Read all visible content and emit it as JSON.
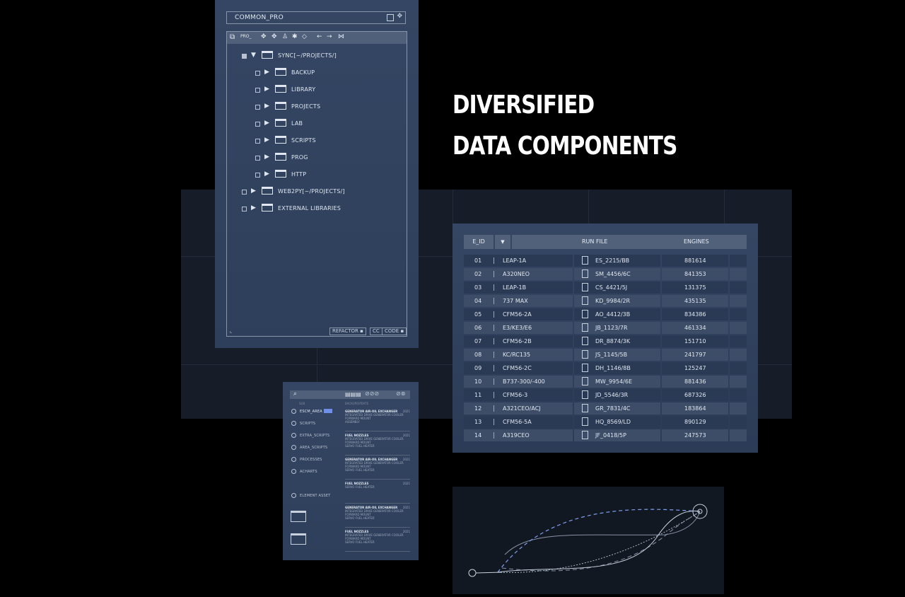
{
  "headline": {
    "line1": "DIVERSIFIED",
    "line2": "DATA COMPONENTS"
  },
  "tree": {
    "title": "COMMON_PRO",
    "toolbar_label": "PRO_",
    "nodes": [
      {
        "label": "SYNC[~/PROJECTS/]",
        "expanded": true,
        "checked": true
      },
      {
        "label": "BACKUP"
      },
      {
        "label": "LIBRARY"
      },
      {
        "label": "PROJECTS"
      },
      {
        "label": "LAB"
      },
      {
        "label": "SCRIPTS"
      },
      {
        "label": "PROG"
      },
      {
        "label": "HTTP"
      },
      {
        "label": "WEB2PY[~/PROJECTS/]"
      },
      {
        "label": "EXTERNAL LIBRARIES"
      }
    ],
    "footer": {
      "refactor": "REFACTOR",
      "cc": "CC",
      "code": "CODE"
    }
  },
  "table": {
    "headers": {
      "id": "E_ID",
      "file": "RUN FILE",
      "engines": "ENGINES"
    },
    "rows": [
      {
        "id": "01",
        "name": "LEAP-1A",
        "file": "ES_2215/BB",
        "engines": "881614"
      },
      {
        "id": "02",
        "name": "A320NEO",
        "file": "SM_4456/6C",
        "engines": "841353"
      },
      {
        "id": "03",
        "name": "LEAP-1B",
        "file": "CS_4421/5J",
        "engines": "131375"
      },
      {
        "id": "04",
        "name": "737 MAX",
        "file": "KD_9984/2R",
        "engines": "435135"
      },
      {
        "id": "05",
        "name": "CFM56-2A",
        "file": "AO_4412/3B",
        "engines": "834386"
      },
      {
        "id": "06",
        "name": "E3/KE3/E6",
        "file": "JB_1123/7R",
        "engines": "461334"
      },
      {
        "id": "07",
        "name": "CFM56-2B",
        "file": "DR_8874/3K",
        "engines": "151710"
      },
      {
        "id": "08",
        "name": "KC/RC135",
        "file": "JS_1145/5B",
        "engines": "241797"
      },
      {
        "id": "09",
        "name": "CFM56-2C",
        "file": "DH_1146/8B",
        "engines": "125247"
      },
      {
        "id": "10",
        "name": "B737-300/-400",
        "file": "MW_9954/6E",
        "engines": "881436"
      },
      {
        "id": "11",
        "name": "CFM56-3",
        "file": "JD_5546/3R",
        "engines": "687326"
      },
      {
        "id": "12",
        "name": "A321CEO/ACJ",
        "file": "GR_7831/4C",
        "engines": "183864"
      },
      {
        "id": "13",
        "name": "CFM56-5A",
        "file": "HQ_8569/LD",
        "engines": "890129"
      },
      {
        "id": "14",
        "name": "A319CEO",
        "file": "JF_0418/5P",
        "engines": "247573"
      }
    ]
  },
  "nav": {
    "section_left": "SUB",
    "section_right": "BACKUP/UPDATE",
    "items": [
      "ESCM_AREA",
      "SCRIPTS",
      "EXTRA_SCRIPTS",
      "AREA_SCRIPTS",
      "PROCESSES",
      "ACHARTS",
      "ELEMENT ASSET"
    ],
    "entries": [
      {
        "title": "GENERATOR AIR-OIL EXCHANGER",
        "year": "2021",
        "lines": [
          "INTEGRATED DRIVE GENERATOR COOLER",
          "FORWARD MOUNT",
          "ASSEMBLY"
        ]
      },
      {
        "title": "FUEL NOZZLES",
        "year": "2021",
        "lines": [
          "INTEGRATED DRIVE GENERATOR COOLER",
          "FORWARD MOUNT",
          "SERVO FUEL HEATER"
        ]
      },
      {
        "title": "GENERATOR AIR-OIL EXCHANGER",
        "year": "2021",
        "lines": [
          "INTEGRATED DRIVE GENERATOR COOLER",
          "FORWARD MOUNT",
          "SERVO FUEL HEATER"
        ]
      },
      {
        "title": "FUEL NOZZLES",
        "year": "2021",
        "lines": [
          "SERVO FUEL HEATER"
        ]
      },
      {
        "title": "GENERATOR AIR-OIL EXCHANGER",
        "year": "2021",
        "lines": [
          "INTEGRATED DRIVE GENERATOR COOLER",
          "FORWARD MOUNT",
          "SERVO FUEL HEATER"
        ]
      },
      {
        "title": "FUEL NOZZLES",
        "year": "2021",
        "lines": [
          "INTEGRATED DRIVE GENERATOR COOLER",
          "FORWARD MOUNT",
          "SERVO FUEL HEATER"
        ]
      }
    ]
  },
  "colors": {
    "accent": "#6f8fe8",
    "panel": "#344663",
    "header": "#52617a"
  }
}
